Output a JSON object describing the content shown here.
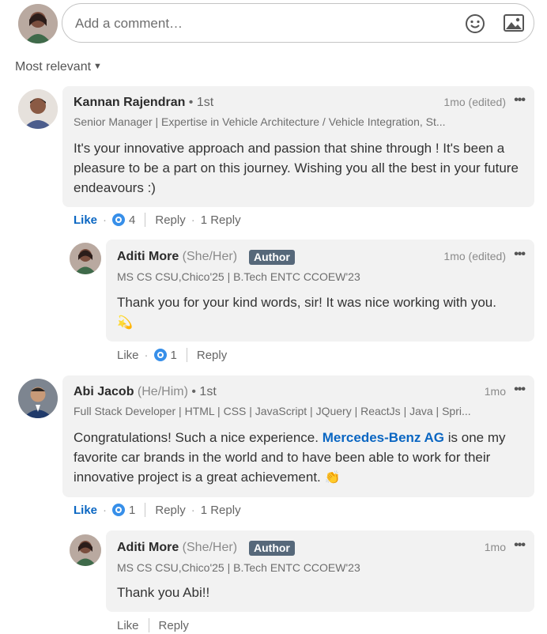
{
  "composer": {
    "placeholder": "Add a comment…"
  },
  "sort": {
    "label": "Most relevant"
  },
  "comments": [
    {
      "name": "Kannan Rajendran",
      "degree": " • 1st",
      "headline": "Senior Manager | Expertise in Vehicle Architecture / Vehicle Integration, St...",
      "time": "1mo (edited)",
      "text": "It's your innovative approach and passion that shine through ! It's been a pleasure to be a part on this journey. Wishing you all the best in your future endeavours :)",
      "actions": {
        "like": "Like",
        "reactions": "4",
        "reply": "Reply",
        "replies": "1 Reply"
      },
      "reply": {
        "name": "Aditi More",
        "pronouns": "(She/Her)",
        "badge": "Author",
        "headline": "MS CS CSU,Chico'25 | B.Tech ENTC CCOEW'23",
        "time": "1mo (edited)",
        "text": "Thank you for your kind words, sir! It was nice working with you.",
        "emoji": "💫",
        "actions": {
          "like": "Like",
          "reactions": "1",
          "reply": "Reply"
        }
      }
    },
    {
      "name": "Abi Jacob",
      "pronouns": "(He/Him)",
      "degree": " • 1st",
      "headline": "Full Stack Developer | HTML | CSS | JavaScript | JQuery | ReactJs | Java | Spri...",
      "time": "1mo",
      "text_before": "Congratulations! Such a nice experience. ",
      "mention": "Mercedes-Benz AG",
      "text_after": " is one my favorite car brands in the world and to have been able to work for their innovative project is a great achievement. ",
      "emoji": "👏",
      "actions": {
        "like": "Like",
        "reactions": "1",
        "reply": "Reply",
        "replies": "1 Reply"
      },
      "reply": {
        "name": "Aditi More",
        "pronouns": "(She/Her)",
        "badge": "Author",
        "headline": "MS CS CSU,Chico'25 | B.Tech ENTC CCOEW'23",
        "time": "1mo",
        "text": "Thank you Abi!!",
        "actions": {
          "like": "Like",
          "reply": "Reply"
        }
      }
    }
  ],
  "colors": {
    "bubble": "#f2f2f2",
    "link": "#0a66c2",
    "badge": "#56687a",
    "like_icon": "#378fe9"
  },
  "icons": [
    "emoji-icon",
    "image-icon",
    "caret-down-icon",
    "more-options-icon",
    "like-reaction-icon"
  ]
}
